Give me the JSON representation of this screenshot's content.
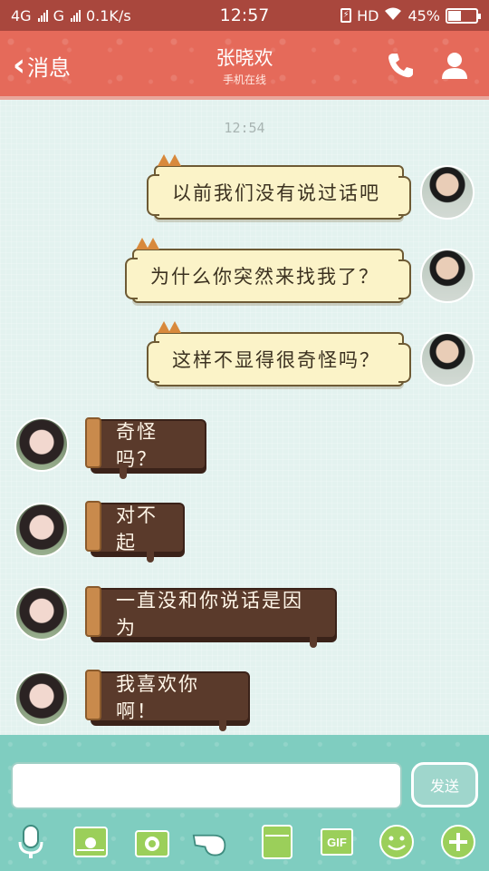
{
  "status_bar": {
    "network_1": "4G",
    "network_2": "G",
    "speed": "0.1K/s",
    "time": "12:57",
    "hd": "HD",
    "battery_percent": "45%",
    "battery_level": 0.45
  },
  "header": {
    "back_label": "消息",
    "contact_name": "张晓欢",
    "contact_status": "手机在线",
    "icons": [
      "phone-icon",
      "profile-icon"
    ],
    "bar_color": "#e56a5a"
  },
  "chat": {
    "timestamp": "12:54",
    "outgoing": [
      {
        "text": "以前我们没有说过话吧"
      },
      {
        "text": "为什么你突然来找我了？"
      },
      {
        "text": "这样不显得很奇怪吗？"
      }
    ],
    "incoming": [
      {
        "text": "奇怪吗？"
      },
      {
        "text": "对不起"
      },
      {
        "text": "一直没和你说话是因为"
      },
      {
        "text": "我喜欢你啊！"
      }
    ]
  },
  "input": {
    "value": "",
    "placeholder": "",
    "send_label": "发送"
  },
  "toolbar": {
    "icons": [
      "microphone-icon",
      "image-icon",
      "camera-icon",
      "whistle-icon",
      "file-icon",
      "gif-icon",
      "emoji-icon",
      "plus-icon"
    ],
    "gif_label": "GIF"
  },
  "colors": {
    "status_bar": "#a9473d",
    "bubble_out": "#fbf3c8",
    "bubble_in": "#5a3a2b",
    "input_bar": "#7fcdc0"
  }
}
